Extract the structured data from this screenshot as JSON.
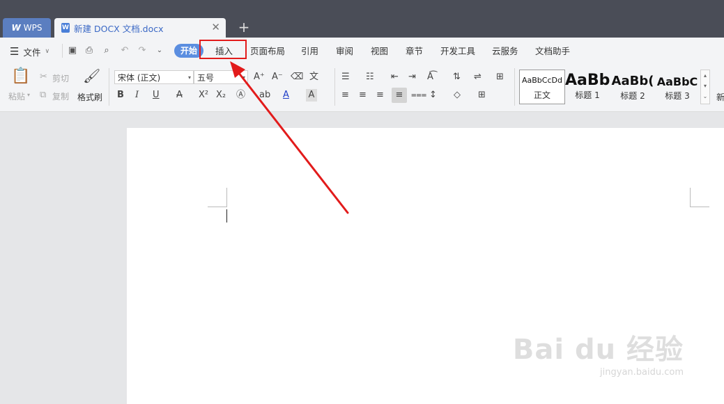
{
  "tabs": {
    "app_label": "WPS",
    "doc_title": "新建 DOCX 文档.docx",
    "close_glyph": "✕",
    "new_glyph": "+"
  },
  "menu": {
    "file": "文件",
    "items": [
      "开始",
      "插入",
      "页面布局",
      "引用",
      "审阅",
      "视图",
      "章节",
      "开发工具",
      "云服务",
      "文档助手"
    ]
  },
  "ribbon": {
    "paste": "粘贴",
    "cut": "剪切",
    "copy": "复制",
    "format_painter": "格式刷",
    "font_name": "宋体 (正文)",
    "font_size": "五号"
  },
  "styles": [
    {
      "preview": "AaBbCcDd",
      "label": "正文"
    },
    {
      "preview": "AaBb",
      "label": "标题 1"
    },
    {
      "preview": "AaBb(",
      "label": "标题 2"
    },
    {
      "preview": "AaBbC",
      "label": "标题 3"
    }
  ],
  "new_style_partial": "新",
  "watermark": {
    "main": "Bai du 经验",
    "sub": "jingyan.baidu.com"
  },
  "colors": {
    "accent": "#5b8ee0",
    "annotation": "#e21b1b",
    "titlebar": "#4a4d57"
  }
}
